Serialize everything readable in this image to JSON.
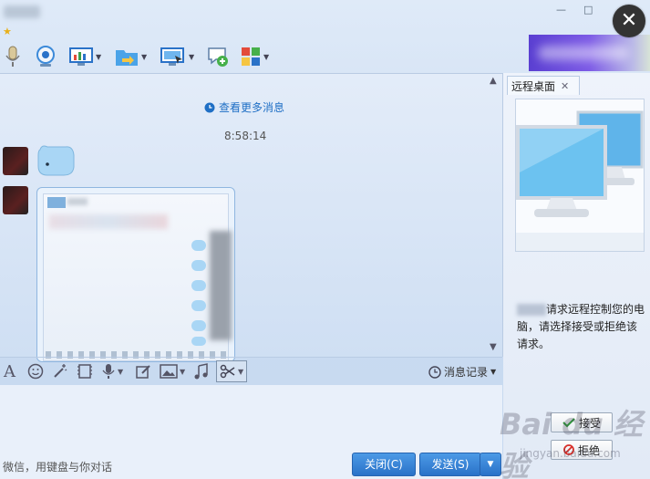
{
  "window": {
    "star_glyph": "★",
    "minimize_glyph": "—",
    "maximize_glyph": "□",
    "close_glyph": "✕"
  },
  "toolbar": {
    "icons": [
      "microphone-icon",
      "webcam-icon",
      "screen-share-icon",
      "file-transfer-icon",
      "remote-desktop-icon",
      "add-app-icon",
      "apps-grid-icon"
    ]
  },
  "chat": {
    "more_messages": "查看更多消息",
    "timestamp": "8:58:14"
  },
  "input_toolbar": {
    "font_glyph": "A",
    "history_label": "消息记录"
  },
  "input": {
    "hint": "微信，用键盘与你对话"
  },
  "buttons": {
    "close_label": "关闭(C)",
    "send_label": "发送(S)"
  },
  "right_panel": {
    "tab_label": "远程桌面",
    "request_text": "请求远程控制您的电脑，请选择接受或拒绝该请求。",
    "accept_label": "接受",
    "reject_label": "拒绝"
  },
  "watermark": {
    "brand": "Bai du 经验",
    "url": "jingyan.baidu.com"
  },
  "colors": {
    "accent": "#2a72c8",
    "link": "#1f6fc5",
    "close_circle": "#333333",
    "banner": "#5a3fd1"
  }
}
